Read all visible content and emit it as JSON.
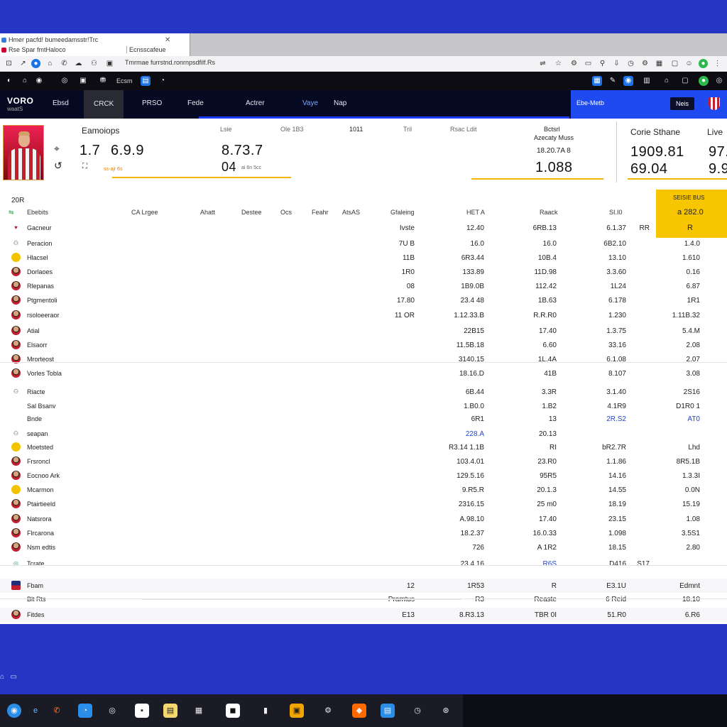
{
  "browser": {
    "tab_line1": "Hmer pacfd! bumeedamsstr!Trc",
    "tab_line2": "Rse  Spar fmtHaloco",
    "tab_line3": "Ecnsscafeue",
    "url": "Tmrmae  furrstnd.ronrnpsdfilf.Rs"
  },
  "bookmarks": {
    "label": "Ecsm"
  },
  "site": {
    "brand": "VORO",
    "brand_sub": "waatS",
    "nav": [
      "Ebsd",
      "CRCK",
      "PRSO",
      "Fede",
      "Actrer",
      "Vaye",
      "Nap"
    ],
    "right_label": "Ebe-Metb",
    "right_button": "Neis"
  },
  "summary": {
    "title": "Eamoiops",
    "val1": "1.7",
    "val2": "6.9.9",
    "mid_head1": "Lsie",
    "mid_head2": "Ole 1B3",
    "mid_big1": "8.73.7",
    "mid_big2": "04",
    "mid_small": "ai 6n 5cc",
    "orange": "ss-ajr 6s",
    "col_a": "1011",
    "col_b": "Tril",
    "col_c": "Rsac Ldit",
    "right_head1": "Bctsrl",
    "right_head2": "Azecaty Muss",
    "right_small": "18.20.7A 8",
    "right_big": "1.088",
    "far_title": "Corie Sthane",
    "far_v1": "1909.81",
    "far_v2": "69.04",
    "live_title": "Live",
    "live_v1": "97.",
    "live_v2": "9.9"
  },
  "table": {
    "season": "20R",
    "highlight": {
      "line1": "SEISIE BUS",
      "line2": "a 282.0",
      "line3": "R"
    },
    "headers": [
      "Ebebits",
      "CA Lrgee",
      "Ahatt",
      "Destee",
      "Ocs",
      "Feahr",
      "AtsAS",
      "Gfaleing",
      "HET A",
      "Raack",
      "SI.I0"
    ],
    "rows": [
      {
        "name": "Gacneur",
        "av": "red",
        "c1": "Ivste",
        "c2": "12.40",
        "c3": "6RB.13",
        "c4": "6.1.37",
        "c5": "RR",
        "hl": ""
      },
      {
        "name": "Peracion",
        "av": "plain",
        "c1": "7U B",
        "c2": "16.0",
        "c3": "16.0",
        "c4": "6B2.10",
        "c5": "",
        "hl": "1.4.0"
      },
      {
        "name": "Hlacsel",
        "av": "yellow",
        "c1": "11B",
        "c2": "6R3.44",
        "c3": "10B.4",
        "c4": "13.10",
        "c5": "",
        "hl": "1.610"
      },
      {
        "name": "Dorlaoes",
        "av": "face",
        "c1": "1R0",
        "c2": "133.89",
        "c3": "11D.98",
        "c4": "3.3.60",
        "c5": "",
        "hl": "0.16"
      },
      {
        "name": "Rlepanas",
        "av": "face",
        "c1": "08",
        "c2": "1B9.0B",
        "c3": "112.42",
        "c4": "1L24",
        "c5": "",
        "hl": "6.87"
      },
      {
        "name": "Ptgmentoli",
        "av": "face",
        "c1": "17.80",
        "c2": "23.4 48",
        "c3": "1B.63",
        "c4": "6.178",
        "c5": "",
        "hl": "1R1"
      },
      {
        "name": "rsoloeeraor",
        "av": "face",
        "c1": "11 OR",
        "c2": "1.12.33.B",
        "c3": "R.R.R0",
        "c4": "1.230",
        "c5": "",
        "hl": "1.11B.32"
      },
      {
        "name": "Atial",
        "av": "face",
        "c1": "",
        "c2": "22B15",
        "c3": "17.40",
        "c4": "1.3.75",
        "c5": "",
        "hl": "5.4.M"
      },
      {
        "name": "Elsaorr",
        "av": "face",
        "c1": "",
        "c2": "11.5B.18",
        "c3": "6.60",
        "c4": "33.16",
        "c5": "",
        "hl": "2.08"
      },
      {
        "name": "Mrorteost",
        "av": "face",
        "c1": "",
        "c2": "3140.15",
        "c3": "1L.4A",
        "c4": "6.1.08",
        "c5": "",
        "hl": "2.07"
      },
      {
        "name": "Vorles Tobla",
        "av": "face",
        "c1": "",
        "c2": "18.16.D",
        "c3": "41B",
        "c4": "8.107",
        "c5": "",
        "hl": "3.08"
      },
      {
        "name": "Riacte",
        "av": "plain",
        "c1": "",
        "c2": "6B.44",
        "c3": "3.3R",
        "c4": "3.1.40",
        "c5": "",
        "hl": "2S16"
      },
      {
        "name": "Sal Bsanv",
        "av": "none",
        "c1": "",
        "c2": "1.B0.0",
        "c3": "1.B2",
        "c4": "4.1R9",
        "c5": "",
        "hl": "D1R0 1"
      },
      {
        "name": "Bnde",
        "av": "none",
        "c1": "",
        "c2": "6R1",
        "c3": "13",
        "c4": "2R.S2",
        "c5": "",
        "hl": "AT0"
      },
      {
        "name": "seapan",
        "av": "plain",
        "c1": "",
        "c2": "228.A",
        "c3": "20.13",
        "c4": "",
        "c5": "",
        "hl": ""
      },
      {
        "name": "Moetsted",
        "av": "yellow",
        "c1": "",
        "c2": "R3.14 1.1B",
        "c3": "RI",
        "c4": "bR2.7R",
        "c5": "",
        "hl": "Lhd"
      },
      {
        "name": "Frsroncl",
        "av": "face",
        "c1": "",
        "c2": "103.4.01",
        "c3": "23.R0",
        "c4": "1.1.86",
        "c5": "",
        "hl": "8R5.1B"
      },
      {
        "name": "Eocnoo Ark",
        "av": "face",
        "c1": "",
        "c2": "129.5.16",
        "c3": "95R5",
        "c4": "14.16",
        "c5": "",
        "hl": "1.3.3I"
      },
      {
        "name": "Mcarmon",
        "av": "yellow",
        "c1": "",
        "c2": "9.R5.R",
        "c3": "20.1.3",
        "c4": "14.55",
        "c5": "",
        "hl": "0.0N"
      },
      {
        "name": "Ptairtieeld",
        "av": "face",
        "c1": "",
        "c2": "2316.15",
        "c3": "25 m0",
        "c4": "18.19",
        "c5": "",
        "hl": "15.19"
      },
      {
        "name": "Natsrora",
        "av": "face",
        "c1": "",
        "c2": "A.98.10",
        "c3": "17.40",
        "c4": "23.15",
        "c5": "",
        "hl": "1.08"
      },
      {
        "name": "Flrcarona",
        "av": "face",
        "c1": "",
        "c2": "18.2.37",
        "c3": "16.0.33",
        "c4": "1.098",
        "c5": "",
        "hl": "3.5S1"
      },
      {
        "name": "Nsm edtis",
        "av": "face",
        "c1": "",
        "c2": "726",
        "c3": "A 1R2",
        "c4": "18.15",
        "c5": "",
        "hl": "2.80"
      },
      {
        "name": "Tcrate",
        "av": "green",
        "c1": "",
        "c2": "23.4 16",
        "c3": "R6S",
        "c4": "D416",
        "c5": "S17",
        "hl": ""
      },
      {
        "name": "Fbam",
        "av": "flag",
        "c1": "12",
        "c2": "1R53",
        "c3": "R",
        "c4": "E3.1U",
        "c5": "",
        "hl": "Edmnt"
      },
      {
        "name": "Blt Rts",
        "av": "none",
        "c1": "Pramtus",
        "c2": "R3",
        "c3": "Reaste",
        "c4": "6 Reid",
        "c5": "",
        "hl": "18.10"
      },
      {
        "name": "Fitdes",
        "av": "face",
        "c1": "E13",
        "c2": "8.R3.13",
        "c3": "TBR 0I",
        "c4": "51.R0",
        "c5": "",
        "hl": "6.R6"
      }
    ]
  },
  "colors": {
    "desktop": "#2636c4",
    "accent_blue": "#1e4af0",
    "highlight_yellow": "#f7c600"
  }
}
